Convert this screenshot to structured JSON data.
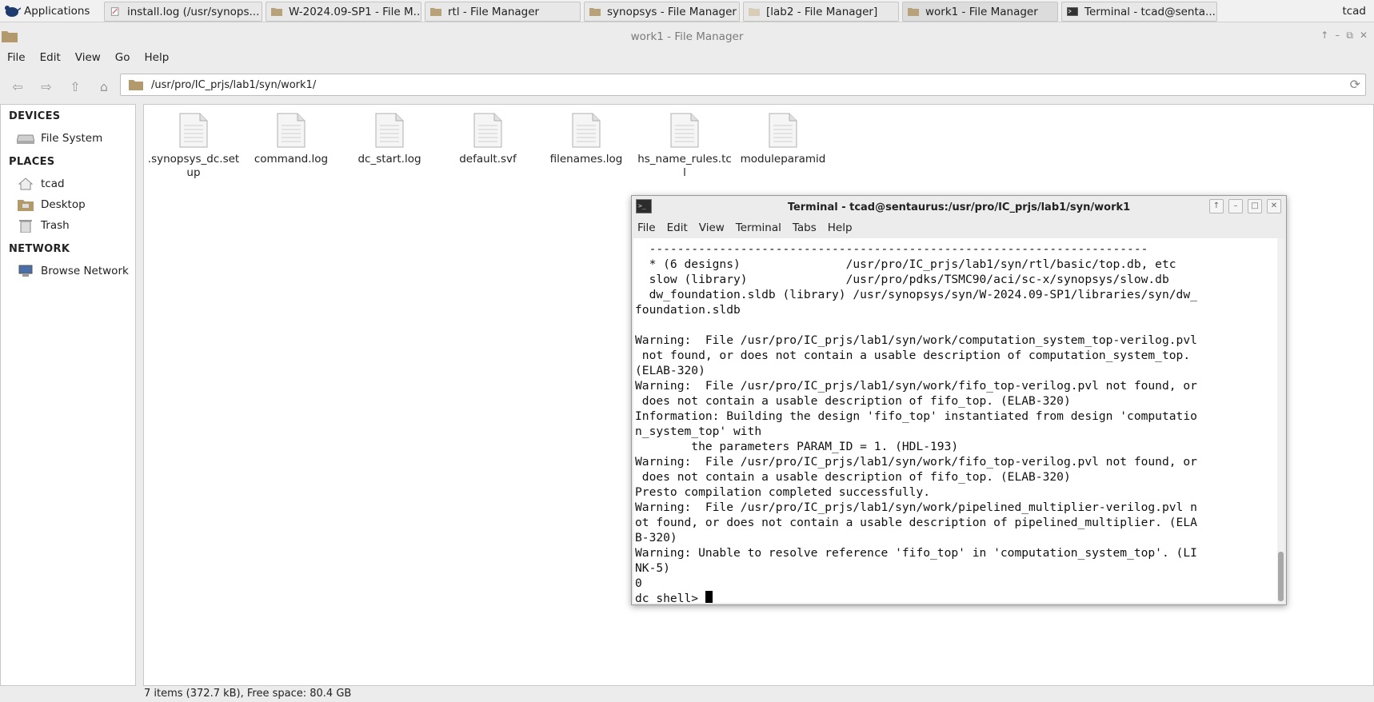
{
  "taskbar": {
    "applications_label": "Applications",
    "tasks": [
      {
        "label": "install.log (/usr/synops..."
      },
      {
        "label": "W-2024.09-SP1 - File M..."
      },
      {
        "label": "rtl - File Manager"
      },
      {
        "label": "synopsys - File Manager"
      },
      {
        "label": "[lab2 - File Manager]"
      },
      {
        "label": "work1 - File Manager"
      },
      {
        "label": "Terminal - tcad@senta..."
      }
    ],
    "user": "tcad"
  },
  "file_manager": {
    "title": "work1 - File Manager",
    "menu": [
      "File",
      "Edit",
      "View",
      "Go",
      "Help"
    ],
    "path": "/usr/pro/IC_prjs/lab1/syn/work1/",
    "sidebar": {
      "devices_label": "DEVICES",
      "devices": [
        {
          "label": "File System"
        }
      ],
      "places_label": "PLACES",
      "places": [
        {
          "label": "tcad"
        },
        {
          "label": "Desktop"
        },
        {
          "label": "Trash"
        }
      ],
      "network_label": "NETWORK",
      "network": [
        {
          "label": "Browse Network"
        }
      ]
    },
    "files": [
      {
        "name": ".synopsys_dc.setup"
      },
      {
        "name": "command.log"
      },
      {
        "name": "dc_start.log"
      },
      {
        "name": "default.svf"
      },
      {
        "name": "filenames.log"
      },
      {
        "name": "hs_name_rules.tcl"
      },
      {
        "name": "moduleparamid"
      }
    ],
    "status": "7 items (372.7 kB), Free space: 80.4 GB"
  },
  "terminal": {
    "title": "Terminal - tcad@sentaurus:/usr/pro/IC_prjs/lab1/syn/work1",
    "icon_text": ">_",
    "menu": [
      "File",
      "Edit",
      "View",
      "Terminal",
      "Tabs",
      "Help"
    ],
    "output": "  -----------------------------------------------------------------------\n  * (6 designs)               /usr/pro/IC_prjs/lab1/syn/rtl/basic/top.db, etc\n  slow (library)              /usr/pro/pdks/TSMC90/aci/sc-x/synopsys/slow.db\n  dw_foundation.sldb (library) /usr/synopsys/syn/W-2024.09-SP1/libraries/syn/dw_\nfoundation.sldb\n\nWarning:  File /usr/pro/IC_prjs/lab1/syn/work/computation_system_top-verilog.pvl\n not found, or does not contain a usable description of computation_system_top.\n(ELAB-320)\nWarning:  File /usr/pro/IC_prjs/lab1/syn/work/fifo_top-verilog.pvl not found, or\n does not contain a usable description of fifo_top. (ELAB-320)\nInformation: Building the design 'fifo_top' instantiated from design 'computatio\nn_system_top' with\n        the parameters PARAM_ID = 1. (HDL-193)\nWarning:  File /usr/pro/IC_prjs/lab1/syn/work/fifo_top-verilog.pvl not found, or\n does not contain a usable description of fifo_top. (ELAB-320)\nPresto compilation completed successfully.\nWarning:  File /usr/pro/IC_prjs/lab1/syn/work/pipelined_multiplier-verilog.pvl n\not found, or does not contain a usable description of pipelined_multiplier. (ELA\nB-320)\nWarning: Unable to resolve reference 'fifo_top' in 'computation_system_top'. (LI\nNK-5)\n0",
    "prompt": "dc_shell> "
  }
}
